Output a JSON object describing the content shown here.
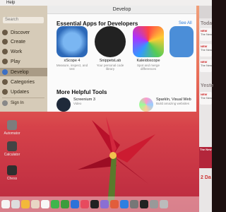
{
  "menubar": {
    "items": [
      "",
      "Help"
    ]
  },
  "window": {
    "title": "Develop"
  },
  "sidebar": {
    "search_placeholder": "Search",
    "items": [
      {
        "label": "Discover",
        "color": "#6a5a45"
      },
      {
        "label": "Create",
        "color": "#6a5a45"
      },
      {
        "label": "Work",
        "color": "#6a5a45"
      },
      {
        "label": "Play",
        "color": "#6a5a45"
      },
      {
        "label": "Develop",
        "color": "#3b6fc4"
      },
      {
        "label": "Categories",
        "color": "#6a5a45"
      },
      {
        "label": "Updates",
        "color": "#6a5a45"
      }
    ],
    "signin": "Sign In"
  },
  "main": {
    "essential_heading": "Essential Apps for Developers",
    "see_all": "See All",
    "apps": [
      {
        "name": "xScope 4",
        "desc": "Measure, inspect, and test"
      },
      {
        "name": "SnippetsLab",
        "desc": "Your personal code library"
      },
      {
        "name": "Kaleidoscope",
        "desc": "Spot and merge differences"
      },
      {
        "name": "",
        "desc": ""
      }
    ],
    "tools_heading": "More Helpful Tools",
    "tools": [
      {
        "name": "Screenium 3",
        "desc": "Video"
      },
      {
        "name": "SparkIn, Visual Web",
        "desc": "Build amazing websites"
      }
    ]
  },
  "desktop_apps": [
    "Automator",
    "Calculator",
    "Chess"
  ],
  "notification_center": {
    "days": [
      "Toda",
      "Yeste",
      "2 Da"
    ],
    "cards": [
      {
        "title": "NEW",
        "line": "The New"
      },
      {
        "title": "NEW",
        "line": "The New"
      },
      {
        "title": "NEW",
        "line": "The New"
      },
      {
        "title": "NEW",
        "line": "The New"
      },
      {
        "title": "NEW",
        "line": "The New"
      }
    ]
  }
}
